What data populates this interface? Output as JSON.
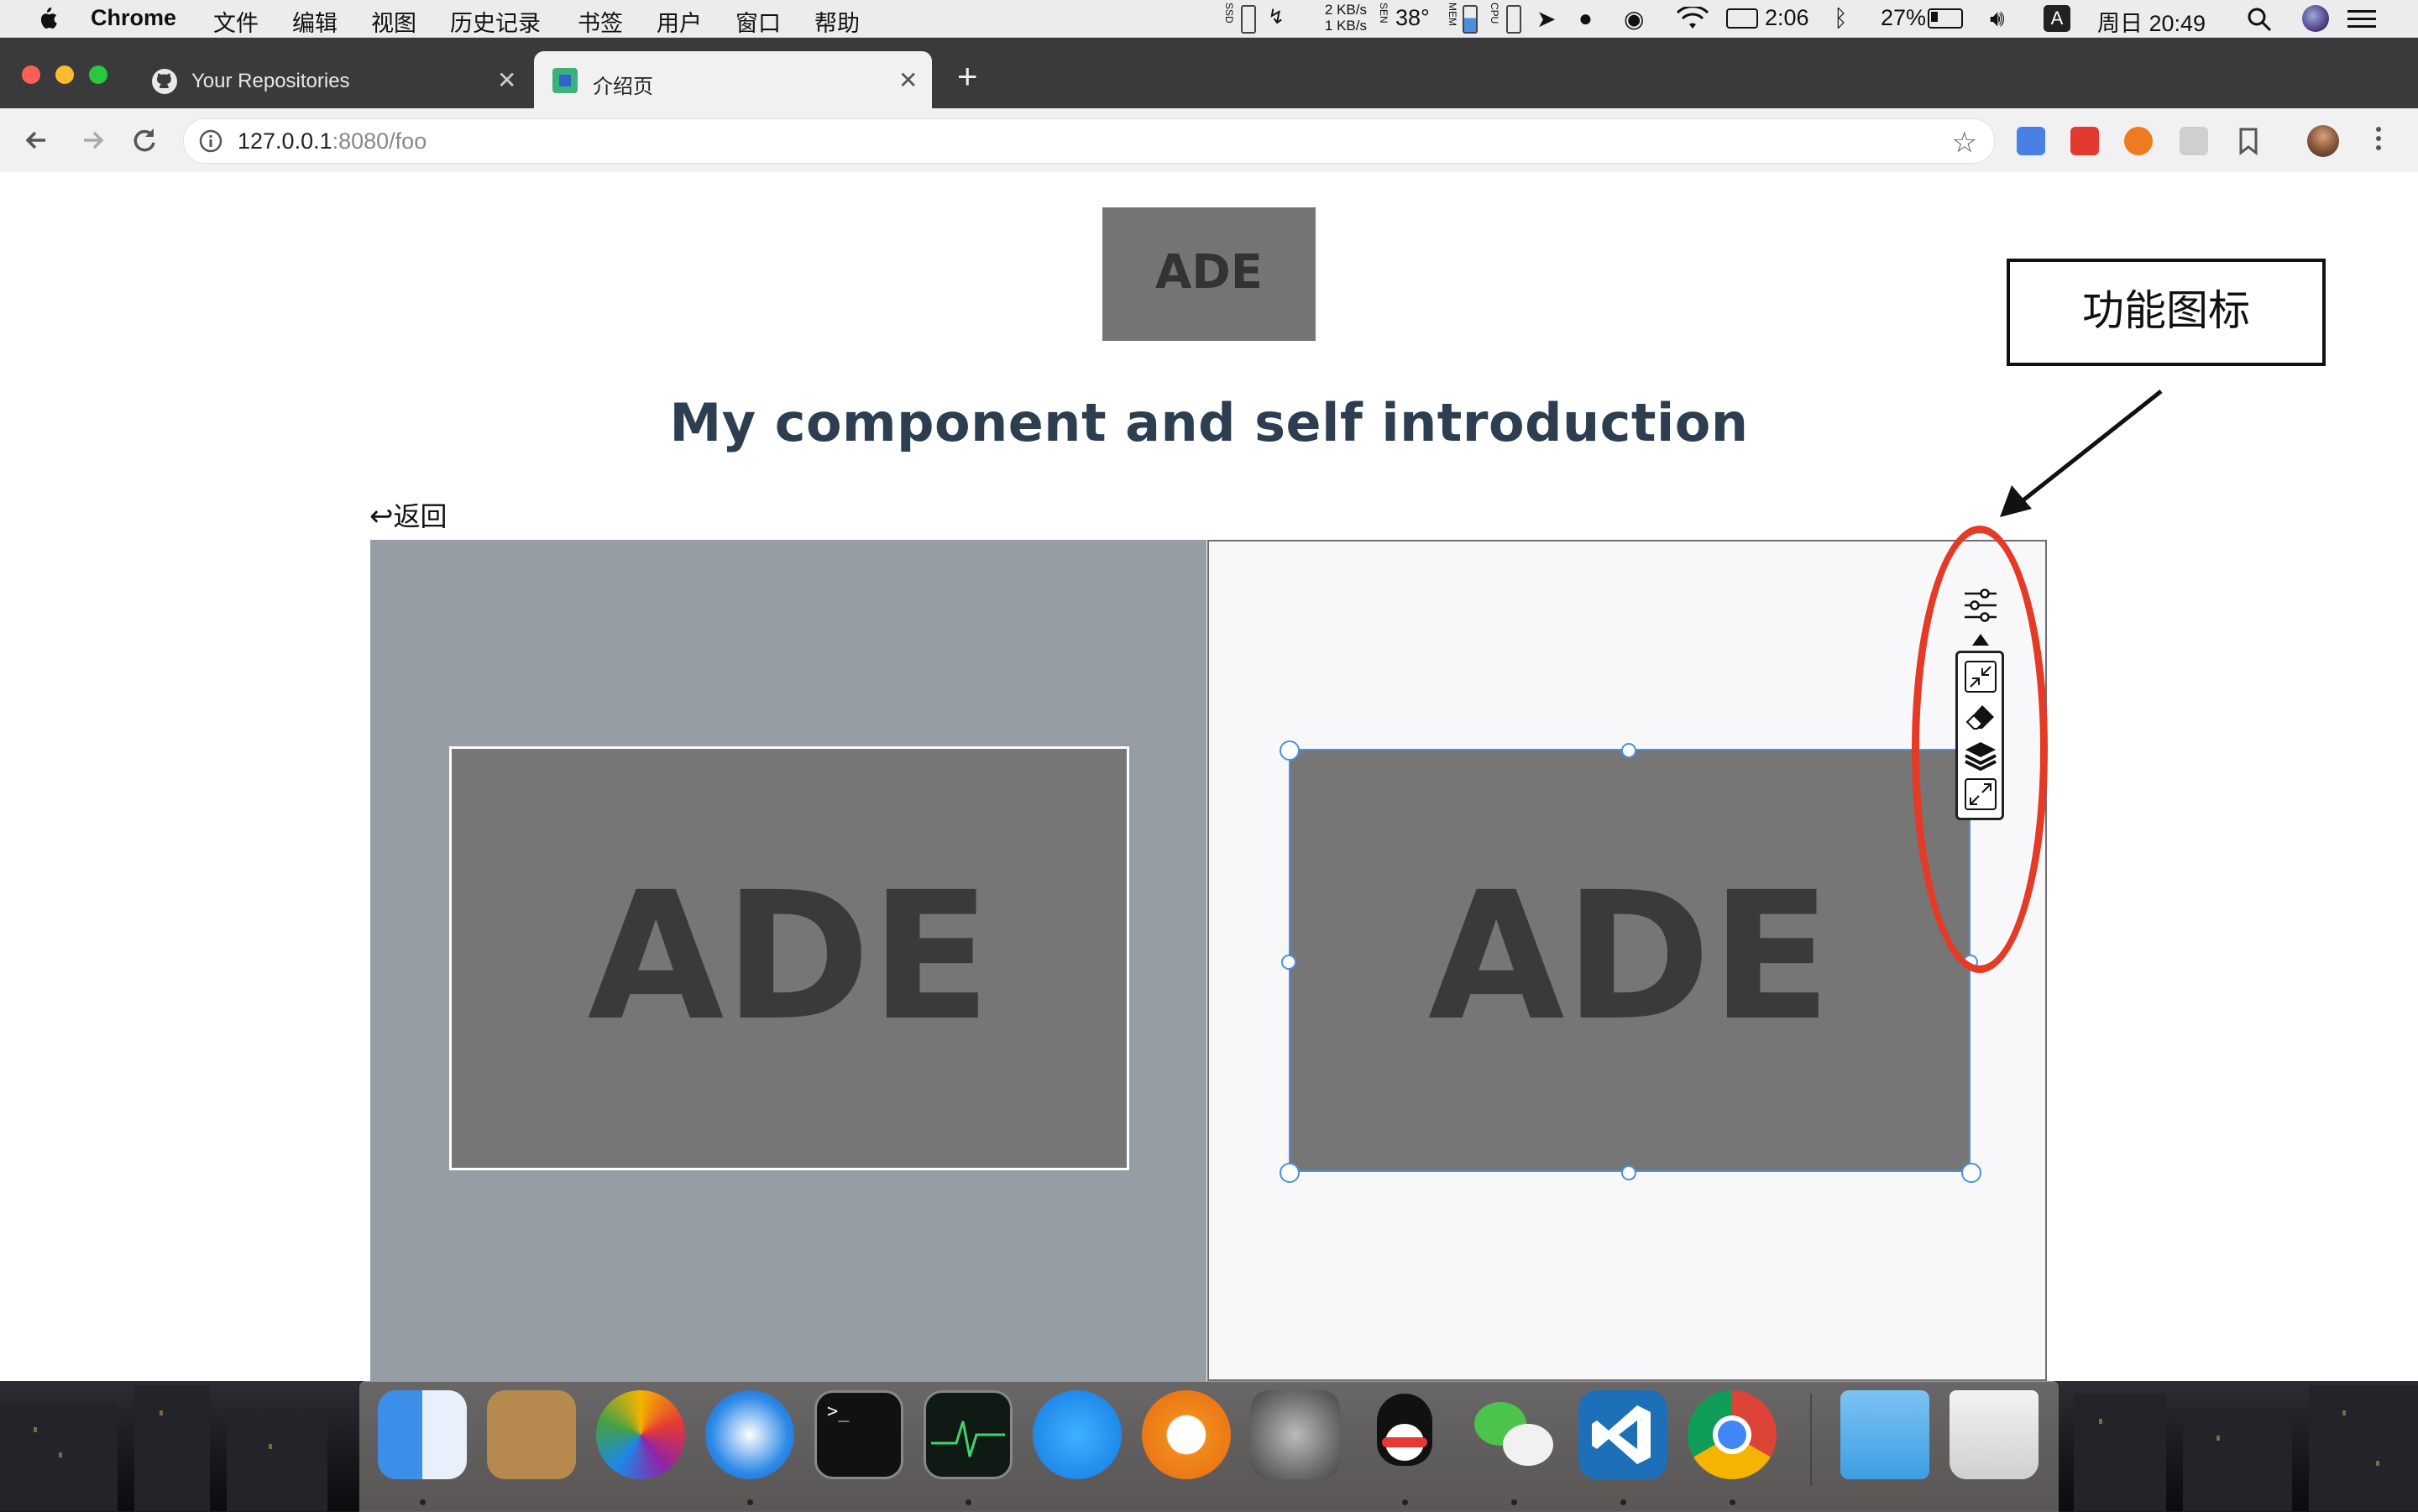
{
  "menubar": {
    "app_name": "Chrome",
    "menus": [
      "文件",
      "编辑",
      "视图",
      "历史记录",
      "书签",
      "用户",
      "窗口",
      "帮助"
    ],
    "status": {
      "ssd_label": "SSD",
      "net_up": "2 KB/s",
      "net_down": "1 KB/s",
      "sen_label": "SEN",
      "temperature": "38°",
      "mem_label": "MEM",
      "cpu_label": "CPU",
      "battery_time": "2:06",
      "battery_percent": "27%",
      "input_source": "A",
      "datetime": "周日 20:49"
    }
  },
  "browser": {
    "tabs": [
      {
        "title": "Your Repositories",
        "active": false
      },
      {
        "title": "介绍页",
        "active": true
      }
    ],
    "new_tab": "+",
    "address": {
      "host": "127.0.0.1",
      "path": ":8080/foo"
    }
  },
  "page": {
    "logo_text": "ADE",
    "title": "My component and self introduction",
    "back_label": "返回"
  },
  "annotation": {
    "callout_text": "功能图标",
    "highlight_color": "#e53a26"
  },
  "editor_tools": [
    "sliders-icon",
    "shrink-icon",
    "eraser-icon",
    "layers-icon",
    "expand-icon"
  ],
  "dock": [
    "Finder",
    "Contacts",
    "Photos",
    "Safari",
    "Terminal",
    "Activity Monitor",
    "App Store",
    "iBooks",
    "System Preferences",
    "QQ",
    "WeChat",
    "Visual Studio Code",
    "Google Chrome",
    "Folder",
    "Trash"
  ],
  "colors": {
    "title": "#2c3e50",
    "selection": "#4a90e2",
    "panel_left": "#979da5",
    "panel_right": "#f8f8fa"
  }
}
